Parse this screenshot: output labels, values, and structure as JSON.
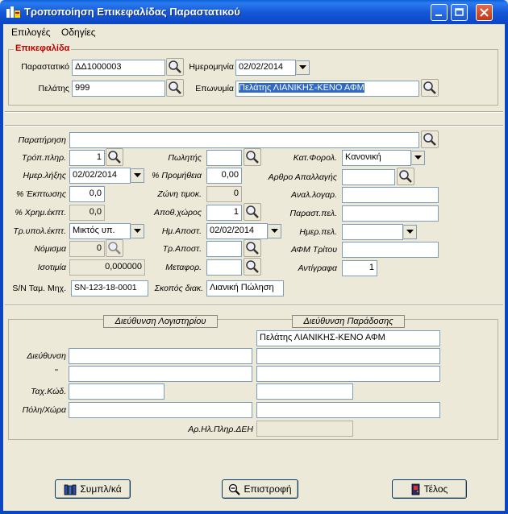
{
  "window": {
    "title": "Τροποποίηση Επικεφαλίδας Παραστατικού"
  },
  "menu": {
    "items": [
      "Επιλογές",
      "Οδηγίες"
    ]
  },
  "header": {
    "group_title": "Επικεφαλίδα",
    "parastatiko_label": "Παραστατικό",
    "parastatiko_value": "ΔΔ1000003",
    "imerominia_label": "Ημερομηνία",
    "imerominia_value": "02/02/2014",
    "pelatis_label": "Πελάτης",
    "pelatis_value": "999",
    "eponymia_label": "Επωνυμία",
    "eponymia_value": "Πελάτης ΛΙΑΝΙΚΗΣ-ΚΕΝΟ ΑΦΜ"
  },
  "details": {
    "paratirisi_label": "Παρατήρηση",
    "paratirisi_value": "",
    "tropos_pliromis_label": "Τρόπ.πληρ.",
    "tropos_pliromis_value": "1",
    "imer_lixis_label": "Ημερ.λήξης",
    "imer_lixis_value": "02/02/2014",
    "ekptosi_label": "% Έκπτωσης",
    "ekptosi_value": "0,0",
    "xrim_ekpt_label": "% Χρημ.έκπτ.",
    "xrim_ekpt_value": "0,0",
    "tr_ypol_ekpt_label": "Τρ.υπολ.έκπτ.",
    "tr_ypol_ekpt_value": "Μικτός υπ.",
    "nomisma_label": "Νόμισμα",
    "nomisma_value": "0",
    "isotimia_label": "Ισοτιμία",
    "isotimia_value": "0,000000",
    "sn_label": "S/N Ταμ. Μηχ.",
    "sn_value": "SN-123-18-0001",
    "politis_label": "Πωλητής",
    "politis_value": "",
    "promitheia_label": "% Προμήθεια",
    "promitheia_value": "0,00",
    "zoni_timok_label": "Ζώνη τιμοκ.",
    "zoni_timok_value": "0",
    "apoth_xoros_label": "Αποθ.χώρος",
    "apoth_xoros_value": "1",
    "im_apost_label": "Ημ.Αποστ.",
    "im_apost_value": "02/02/2014",
    "tr_apost_label": "Τρ.Αποστ.",
    "tr_apost_value": "",
    "metafor_label": "Μεταφορ.",
    "metafor_value": "",
    "skopos_label": "Σκοπός διακ.",
    "skopos_value": "Λιανική Πώληση",
    "kat_forol_label": "Κατ.Φορολ.",
    "kat_forol_value": "Κανονική",
    "arthro_apallagis_label": "Αρθρο Απαλλαγής",
    "arthro_apallagis_value": "",
    "anal_logar_label": "Αναλ.λογαρ.",
    "anal_logar_value": "",
    "parast_pel_label": "Παραστ.πελ.",
    "parast_pel_value": "",
    "imer_pel_label": "Ημερ.πελ.",
    "imer_pel_value": "",
    "afm_tritou_label": "ΑΦΜ Τρίτου",
    "afm_tritou_value": "",
    "antigrafa_label": "Αντίγραφα",
    "antigrafa_value": "1"
  },
  "address": {
    "logistiriou_header": "Διεύθυνση Λογιστηρίου",
    "paradosis_header": "Διεύθυνση Παράδοσης",
    "paradosis_name": "Πελάτης ΛΙΑΝΙΚΗΣ-ΚΕΝΟ ΑΦΜ",
    "dieuthinsi_label": "Διεύθυνση",
    "ditto_label": "''",
    "tax_kod_label": "Ταχ.Κώδ.",
    "poli_xora_label": "Πόλη/Χώρα",
    "ar_il_pliro_label": "Αρ.Ηλ.Πληρ.ΔΕΗ"
  },
  "buttons": {
    "symplka_label": "Συμπλ/κά",
    "epistrofi_label": "Επιστροφή",
    "telos_label": "Τέλος"
  }
}
